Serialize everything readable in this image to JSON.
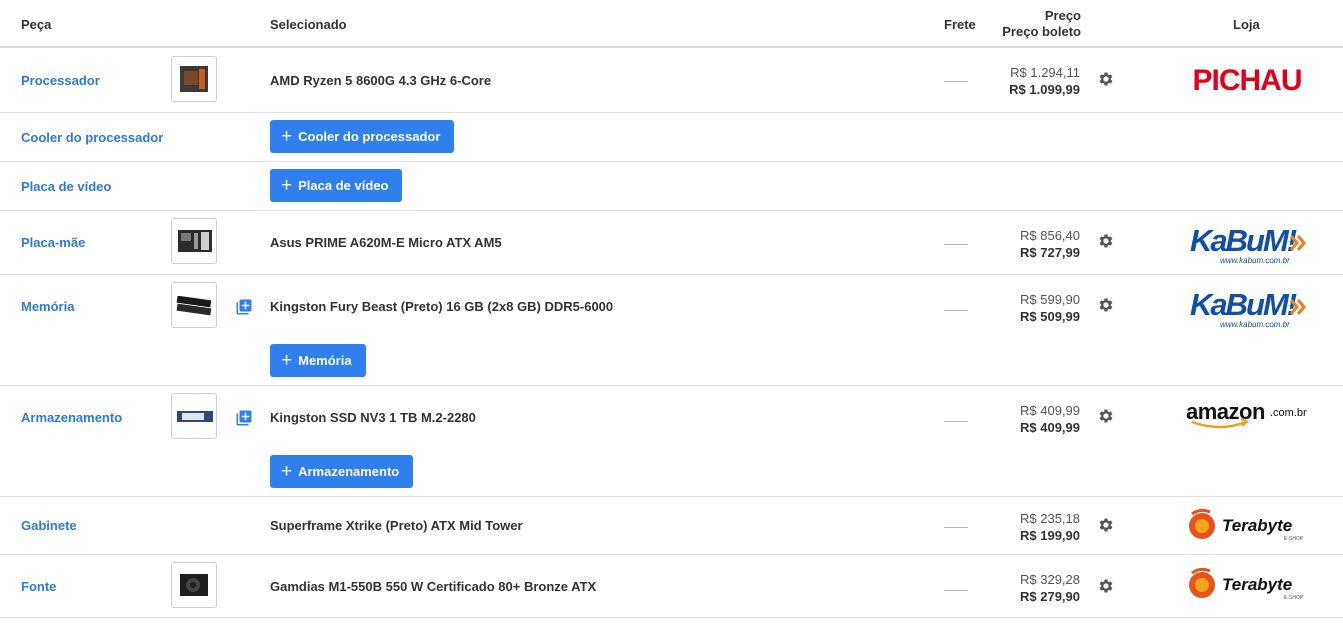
{
  "header": {
    "peca": "Peça",
    "selecionado": "Selecionado",
    "frete": "Frete",
    "preco": "Preço",
    "preco_boleto": "Preço boleto",
    "loja": "Loja"
  },
  "rows": [
    {
      "category": "Processador",
      "product": "AMD Ryzen 5 8600G 4.3 GHz 6-Core",
      "price": "R$ 1.294,11",
      "boleto": "R$ 1.099,99",
      "store": "Pichau",
      "store_logo": "PICHAU"
    },
    {
      "category": "Cooler do processador",
      "button": "Cooler do processador"
    },
    {
      "category": "Placa de vídeo",
      "button": "Placa de vídeo"
    },
    {
      "category": "Placa-mãe",
      "product": "Asus PRIME A620M-E Micro ATX AM5",
      "price": "R$ 856,40",
      "boleto": "R$ 727,99",
      "store": "KaBuM!",
      "store_logo": "KaBuM!",
      "store_sub": "www.kabum.com.br"
    },
    {
      "category": "Memória",
      "product": "Kingston Fury Beast (Preto) 16 GB (2x8 GB) DDR5-6000",
      "price": "R$ 599,90",
      "boleto": "R$ 509,99",
      "store": "KaBuM!",
      "store_logo": "KaBuM!",
      "store_sub": "www.kabum.com.br",
      "button": "Memória"
    },
    {
      "category": "Armazenamento",
      "product": "Kingston SSD NV3 1 TB M.2-2280",
      "price": "R$ 409,99",
      "boleto": "R$ 409,99",
      "store": "Amazon",
      "store_logo": "amazon",
      "store_sub": ".com.br",
      "button": "Armazenamento"
    },
    {
      "category": "Gabinete",
      "product": "Superframe Xtrike (Preto) ATX Mid Tower",
      "price": "R$ 235,18",
      "boleto": "R$ 199,90",
      "store": "Terabyte",
      "store_logo": "Terabyte",
      "store_sub": "E-SHOP"
    },
    {
      "category": "Fonte",
      "product": "Gamdias M1-550B 550 W Certificado 80+ Bronze ATX",
      "price": "R$ 329,28",
      "boleto": "R$ 279,90",
      "store": "Terabyte",
      "store_logo": "Terabyte",
      "store_sub": "E-SHOP"
    }
  ],
  "colors": {
    "link": "#2c7ad6",
    "button": "#2f80ed",
    "pichau": "#e1001a",
    "kabum": "#0e4fa8",
    "kabum_arrow": "#f47a1f",
    "amazon_arrow": "#f29a1f",
    "terabyte_flame": "#e8531c"
  },
  "icons": [
    "gear-icon",
    "add-copy-icon",
    "plus-icon"
  ]
}
